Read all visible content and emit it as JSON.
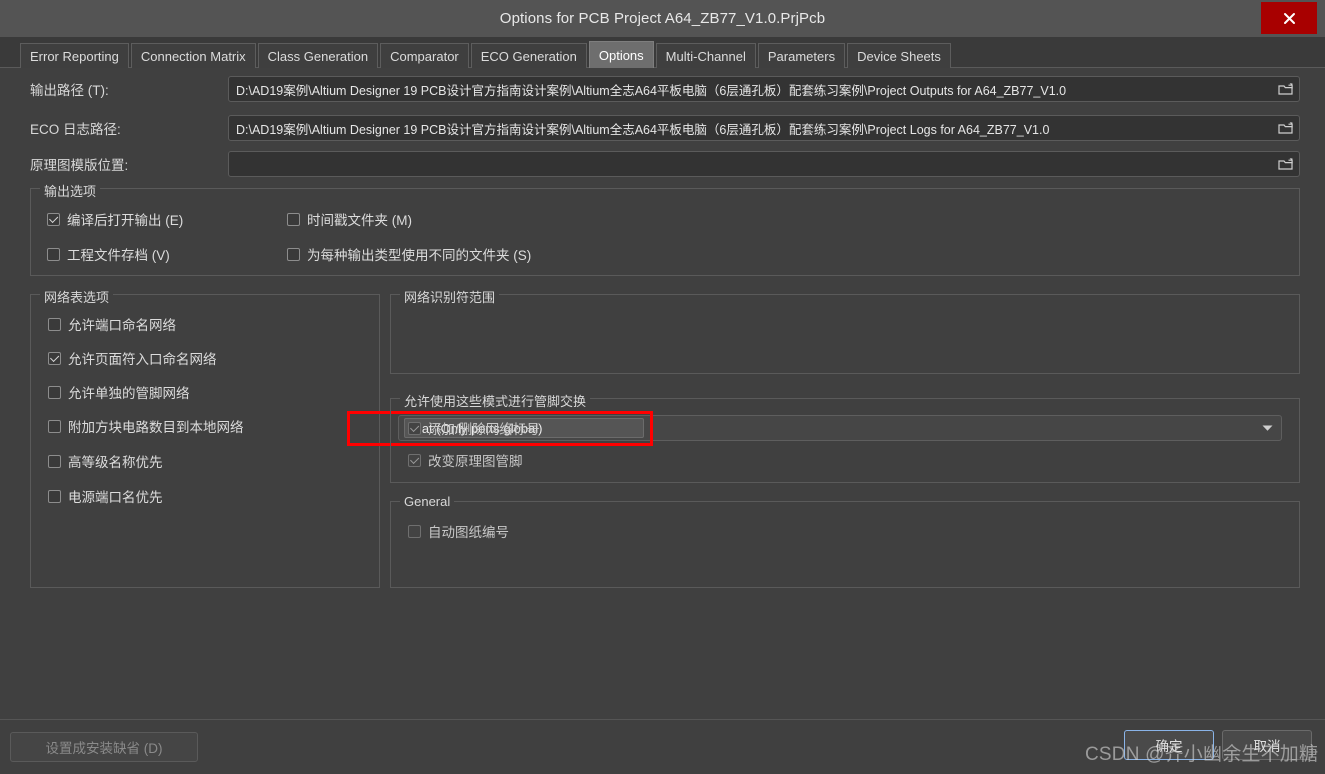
{
  "window": {
    "title": "Options for PCB Project A64_ZB77_V1.0.PrjPcb",
    "close_icon": "close-icon"
  },
  "tabs": [
    {
      "label": "Error Reporting",
      "selected": false
    },
    {
      "label": "Connection Matrix",
      "selected": false
    },
    {
      "label": "Class Generation",
      "selected": false
    },
    {
      "label": "Comparator",
      "selected": false
    },
    {
      "label": "ECO Generation",
      "selected": false
    },
    {
      "label": "Options",
      "selected": true
    },
    {
      "label": "Multi-Channel",
      "selected": false
    },
    {
      "label": "Parameters",
      "selected": false
    },
    {
      "label": "Device Sheets",
      "selected": false
    }
  ],
  "paths": [
    {
      "label": "输出路径 (T):",
      "value": "D:\\AD19案例\\Altium Designer 19 PCB设计官方指南设计案例\\Altium全志A64平板电脑（6层通孔板）配套练习案例\\Project Outputs for A64_ZB77_V1.0",
      "browse_icon": "folder-browse-icon"
    },
    {
      "label": "ECO 日志路径:",
      "value": "D:\\AD19案例\\Altium Designer 19 PCB设计官方指南设计案例\\Altium全志A64平板电脑（6层通孔板）配套练习案例\\Project Logs for A64_ZB77_V1.0",
      "browse_icon": "folder-browse-icon"
    },
    {
      "label": "原理图模版位置:",
      "value": "",
      "browse_icon": "folder-browse-icon"
    }
  ],
  "output_options": {
    "title": "输出选项",
    "items": [
      {
        "label": "编译后打开输出 (E)",
        "checked": true,
        "disabled": false
      },
      {
        "label": "时间戳文件夹 (M)",
        "checked": false,
        "disabled": false
      },
      {
        "label": "工程文件存档 (V)",
        "checked": false,
        "disabled": false
      },
      {
        "label": "为每种输出类型使用不同的文件夹 (S)",
        "checked": false,
        "disabled": false
      }
    ]
  },
  "netlist_options": {
    "title": "网络表选项",
    "items": [
      {
        "label": "允许端口命名网络",
        "checked": false
      },
      {
        "label": "允许页面符入口命名网络",
        "checked": true
      },
      {
        "label": "允许单独的管脚网络",
        "checked": false
      },
      {
        "label": "附加方块电路数目到本地网络",
        "checked": false
      },
      {
        "label": "高等级名称优先",
        "checked": false
      },
      {
        "label": "电源端口名优先",
        "checked": false
      }
    ]
  },
  "net_identifier_scope": {
    "title": "网络识别符范围",
    "selected": "Flat (Only ports global)",
    "dropdown_icon": "chevron-down-icon",
    "highlight_color": "#ff0000"
  },
  "pin_swap": {
    "title": "允许使用这些模式进行管脚交换",
    "items": [
      {
        "label": "添加/删除网络标号",
        "checked": true,
        "disabled": true
      },
      {
        "label": "改变原理图管脚",
        "checked": true,
        "disabled": true
      }
    ]
  },
  "general": {
    "title": "General",
    "items": [
      {
        "label": "自动图纸编号",
        "checked": false,
        "disabled": true
      }
    ]
  },
  "footer": {
    "set_default_label": "设置成安装缺省 (D)",
    "ok_label": "确定",
    "cancel_label": "取消"
  },
  "watermark": {
    "text": "CSDN @齐小幽余生不加糖"
  }
}
